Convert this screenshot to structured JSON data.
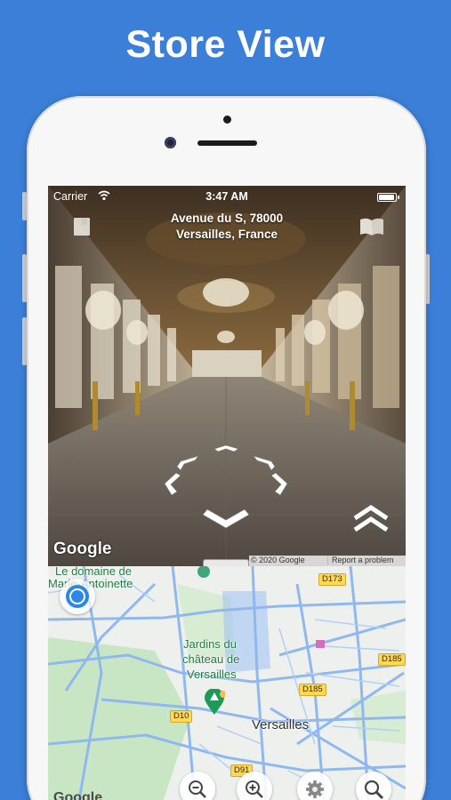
{
  "headline": "Store View",
  "status_bar": {
    "carrier": "Carrier",
    "time": "3:47 AM"
  },
  "street_view": {
    "address_line1": "Avenue du S, 78000",
    "address_line2": "Versailles, France",
    "google": "Google",
    "copyright": "© 2020 Google",
    "report": "Report a problem"
  },
  "map": {
    "labels": {
      "domaine_1": "Le domaine de",
      "domaine_2": "Marie-Antoinette",
      "jardins_1": "Jardins du",
      "jardins_2": "château de",
      "jardins_3": "Versailles",
      "city": "Versailles",
      "google": "Google"
    },
    "roads": {
      "d173": "D173",
      "d185a": "D185",
      "d185b": "D185",
      "d10": "D10",
      "d91": "D91"
    }
  },
  "colors": {
    "background": "#3b7fd9",
    "map_road": "#8fb8f0",
    "map_green": "#c9e6c4",
    "location_blue": "#2e87e6",
    "road_badge": "#ffd85a"
  },
  "icons": [
    "wifi-icon",
    "battery-icon",
    "book-icon",
    "open-book-icon",
    "rotate-arrows-icon",
    "chevron-down-icon",
    "double-chevron-up-icon",
    "my-location-icon",
    "zoom-out-icon",
    "zoom-in-icon",
    "gear-icon",
    "search-icon",
    "park-marker-icon"
  ]
}
